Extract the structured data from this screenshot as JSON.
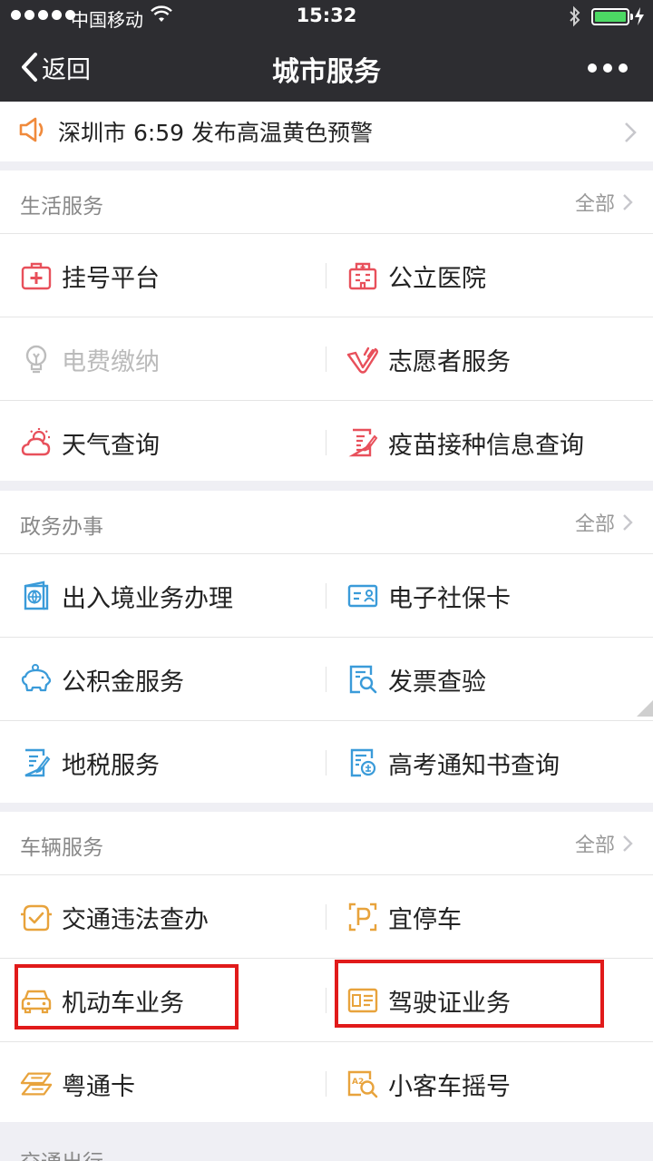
{
  "status_bar": {
    "carrier": "中国移动",
    "time": "15:32"
  },
  "nav": {
    "back_label": "返回",
    "title": "城市服务"
  },
  "alert": {
    "text": "深圳市 6:59 发布高温黄色预警"
  },
  "sections": [
    {
      "title": "生活服务",
      "all_label": "全部",
      "items": [
        {
          "label": "挂号平台",
          "icon": "medical-kit-icon",
          "color": "#e8505b"
        },
        {
          "label": "公立医院",
          "icon": "hospital-icon",
          "color": "#e8505b"
        },
        {
          "label": "电费缴纳",
          "icon": "lightbulb-icon",
          "color": "#bdbdbd",
          "disabled": true
        },
        {
          "label": "志愿者服务",
          "icon": "heart-hand-icon",
          "color": "#e8505b"
        },
        {
          "label": "天气查询",
          "icon": "weather-icon",
          "color": "#e8505b"
        },
        {
          "label": "疫苗接种信息查询",
          "icon": "form-icon",
          "color": "#e8505b"
        }
      ]
    },
    {
      "title": "政务办事",
      "all_label": "全部",
      "items": [
        {
          "label": "出入境业务办理",
          "icon": "passport-icon",
          "color": "#3a9bd9"
        },
        {
          "label": "电子社保卡",
          "icon": "id-card-icon",
          "color": "#3a9bd9"
        },
        {
          "label": "公积金服务",
          "icon": "piggy-bank-icon",
          "color": "#3a9bd9"
        },
        {
          "label": "发票查验",
          "icon": "invoice-search-icon",
          "color": "#3a9bd9"
        },
        {
          "label": "地税服务",
          "icon": "tax-doc-icon",
          "color": "#3a9bd9"
        },
        {
          "label": "高考通知书查询",
          "icon": "notice-icon",
          "color": "#3a9bd9"
        }
      ]
    },
    {
      "title": "车辆服务",
      "all_label": "全部",
      "items": [
        {
          "label": "交通违法查办",
          "icon": "traffic-check-icon",
          "color": "#e8a33c"
        },
        {
          "label": "宜停车",
          "icon": "parking-icon",
          "color": "#e8a33c"
        },
        {
          "label": "机动车业务",
          "icon": "car-icon",
          "color": "#e8a33c"
        },
        {
          "label": "驾驶证业务",
          "icon": "license-icon",
          "color": "#e8a33c"
        },
        {
          "label": "粤通卡",
          "icon": "toll-card-icon",
          "color": "#e8a33c"
        },
        {
          "label": "小客车摇号",
          "icon": "lottery-icon",
          "color": "#e8a33c"
        }
      ]
    }
  ],
  "next_section_title": "交通出行",
  "highlight_color": "#e11a1a"
}
